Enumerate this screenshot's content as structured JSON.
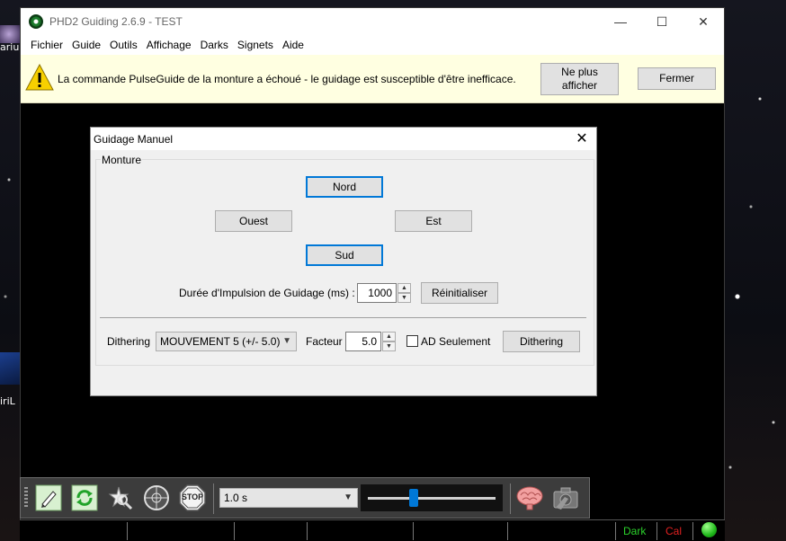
{
  "desktop": {
    "icon_label_1": "ariu",
    "icon_label_2": "iriL"
  },
  "window": {
    "title": "PHD2 Guiding 2.6.9 - TEST",
    "controls": [
      "—",
      "☐",
      "✕"
    ]
  },
  "menu": [
    "Fichier",
    "Guide",
    "Outils",
    "Affichage",
    "Darks",
    "Signets",
    "Aide"
  ],
  "infobar": {
    "message": "La commande PulseGuide de la monture a échoué - le guidage est susceptible d'être inefficace.",
    "dont_show_line1": "Ne plus",
    "dont_show_line2": "afficher",
    "close_label": "Fermer",
    "icon": "warning-icon",
    "warn_color": "#f7d000"
  },
  "dialog": {
    "title": "Guidage Manuel",
    "close": "✕",
    "group_label": "Monture",
    "north": "Nord",
    "west": "Ouest",
    "east": "Est",
    "south": "Sud",
    "pulse_label": "Durée d'Impulsion de Guidage (ms) :",
    "pulse_value": "1000",
    "reset_label": "Réinitialiser",
    "dither_label": "Dithering",
    "dither_mode": "MOUVEMENT 5 (+/- 5.0)",
    "factor_label": "Facteur",
    "factor_value": "5.0",
    "ra_only_label": "AD Seulement",
    "ra_only_checked": false,
    "dither_button": "Dithering"
  },
  "toolbar": {
    "tools": [
      "loop-icon",
      "refresh-icon",
      "star-select-icon",
      "target-icon",
      "stop-icon",
      "brain-icon",
      "camera-settings-icon"
    ],
    "stop_label": "STOP",
    "exposure": "1.0 s",
    "gamma_fraction": 0.36
  },
  "statusbar": {
    "dark": "Dark",
    "dark_color": "#2bd12b",
    "cal": "Cal",
    "cal_color": "#e02020",
    "led_color": "#1fb81a"
  }
}
